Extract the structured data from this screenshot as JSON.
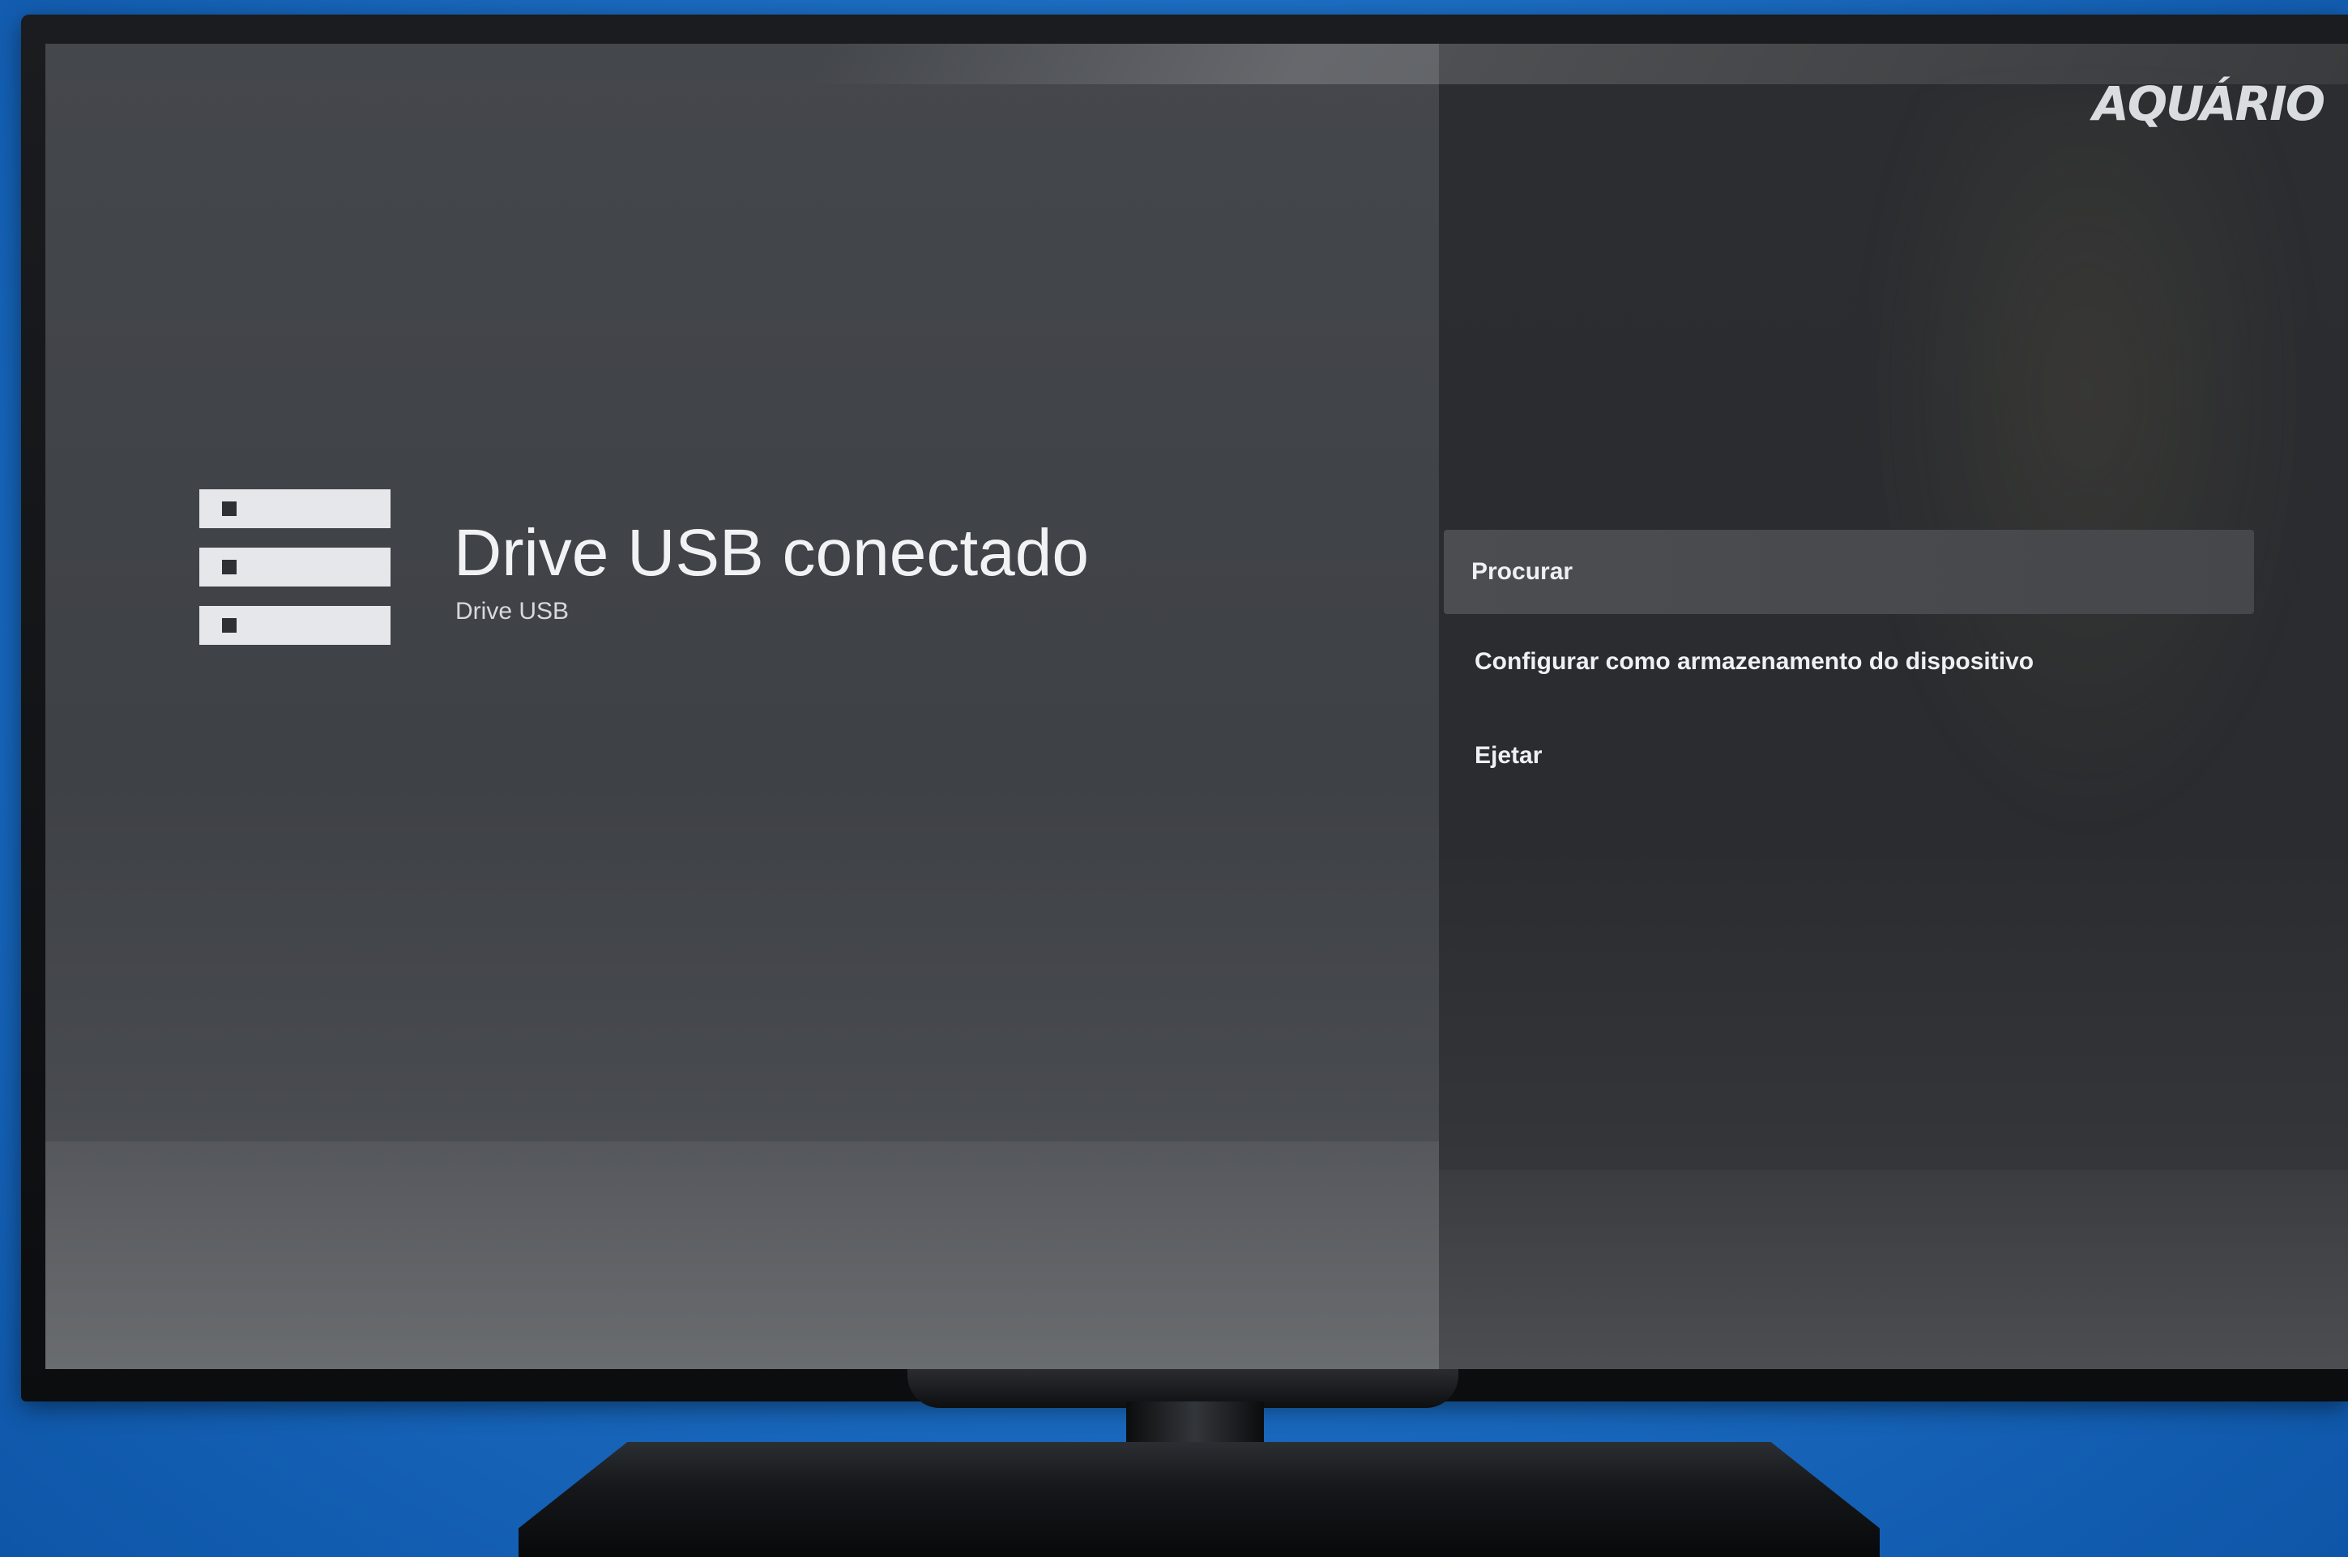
{
  "brand": {
    "logo_text": "AQUÁRIO"
  },
  "storage_dialog": {
    "icon": "usb-drive-icon",
    "title": "Drive USB conectado",
    "subtitle": "Drive USB"
  },
  "menu": {
    "items": [
      {
        "label": "Procurar",
        "selected": true
      },
      {
        "label": "Configurar como armazenamento do dispositivo",
        "selected": false
      },
      {
        "label": "Ejetar",
        "selected": false
      }
    ]
  },
  "colors": {
    "background_blue": "#1d6fc6",
    "left_panel": "#3f4247",
    "right_panel": "#2b2d30",
    "selected_item": "#4b4d51",
    "text": "#f1f2f4"
  }
}
